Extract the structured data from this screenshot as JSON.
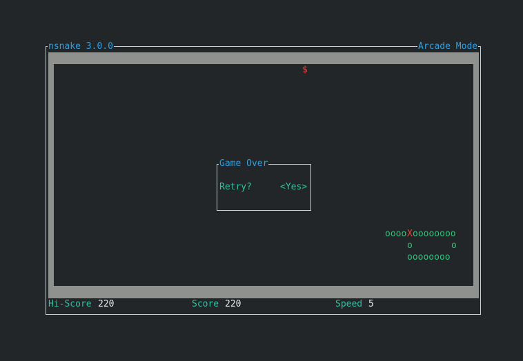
{
  "window": {
    "title": "nsnake 3.0.0",
    "mode": "Arcade Mode"
  },
  "game": {
    "fruit": "$",
    "snake": {
      "row1_left": "oooo",
      "head": "X",
      "row1_right": "oooooooo",
      "row2_left": "o",
      "row2_right": "o",
      "row3": "oooooooo"
    }
  },
  "dialog": {
    "title": "Game Over",
    "prompt": "Retry?",
    "option": "<Yes>"
  },
  "status": {
    "hiscore_label": "Hi-Score",
    "hiscore_value": "220",
    "score_label": "Score",
    "score_value": "220",
    "speed_label": "Speed",
    "speed_value": "5"
  },
  "colors": {
    "background": "#222628",
    "wall": "#8f918f",
    "title_blue": "#2f9ee0",
    "accent_teal": "#2cc3a0",
    "snake_green": "#2cc37a",
    "snake_head": "#e0453a",
    "fruit": "#e0453a",
    "value_white": "#e8ecee"
  }
}
